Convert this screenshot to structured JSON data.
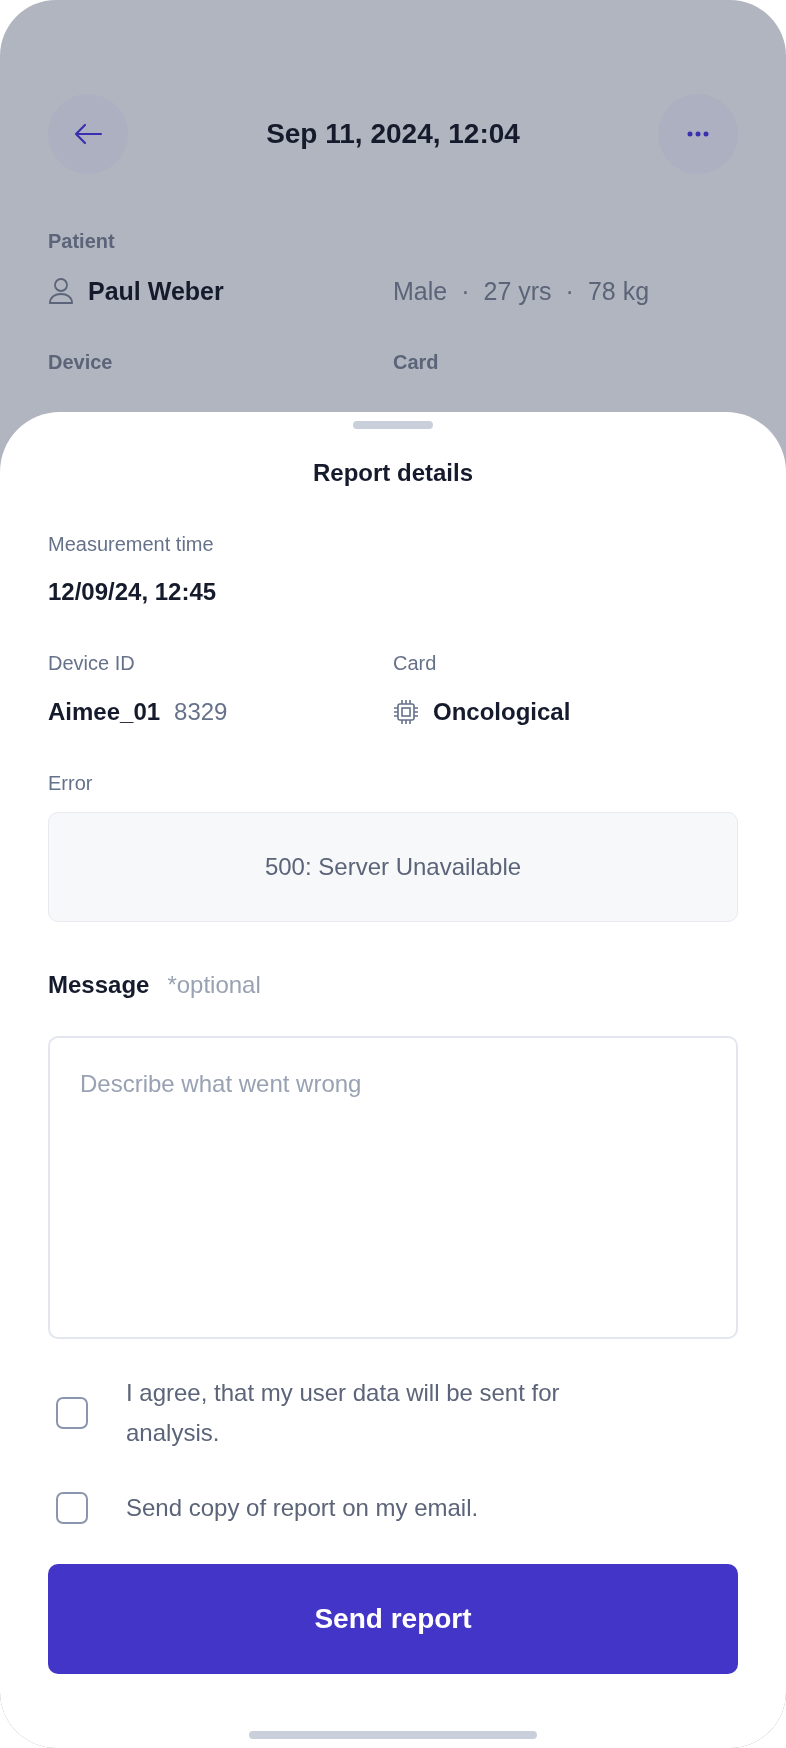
{
  "header": {
    "title": "Sep 11, 2024, 12:04"
  },
  "patient": {
    "label": "Patient",
    "name": "Paul Weber",
    "details": [
      "Male",
      "·",
      "27 yrs",
      "·",
      "78 kg"
    ]
  },
  "device": {
    "label": "Device"
  },
  "card": {
    "label": "Card"
  },
  "sheet": {
    "title": "Report details",
    "measurement": {
      "label": "Measurement time",
      "value": "12/09/24, 12:45"
    },
    "device": {
      "label": "Device ID",
      "name": "Aimee_01",
      "id": "8329"
    },
    "card": {
      "label": "Card",
      "name": "Oncological"
    },
    "error": {
      "label": "Error",
      "text": "500: Server Unavailable"
    },
    "message": {
      "label": "Message",
      "note": "*optional",
      "placeholder": "Describe what went wrong"
    },
    "checkboxes": [
      {
        "label": "I agree, that my user data will be sent for analysis.",
        "checked": false
      },
      {
        "label": "Send copy of report on my email.",
        "checked": false
      }
    ],
    "button": "Send report"
  }
}
